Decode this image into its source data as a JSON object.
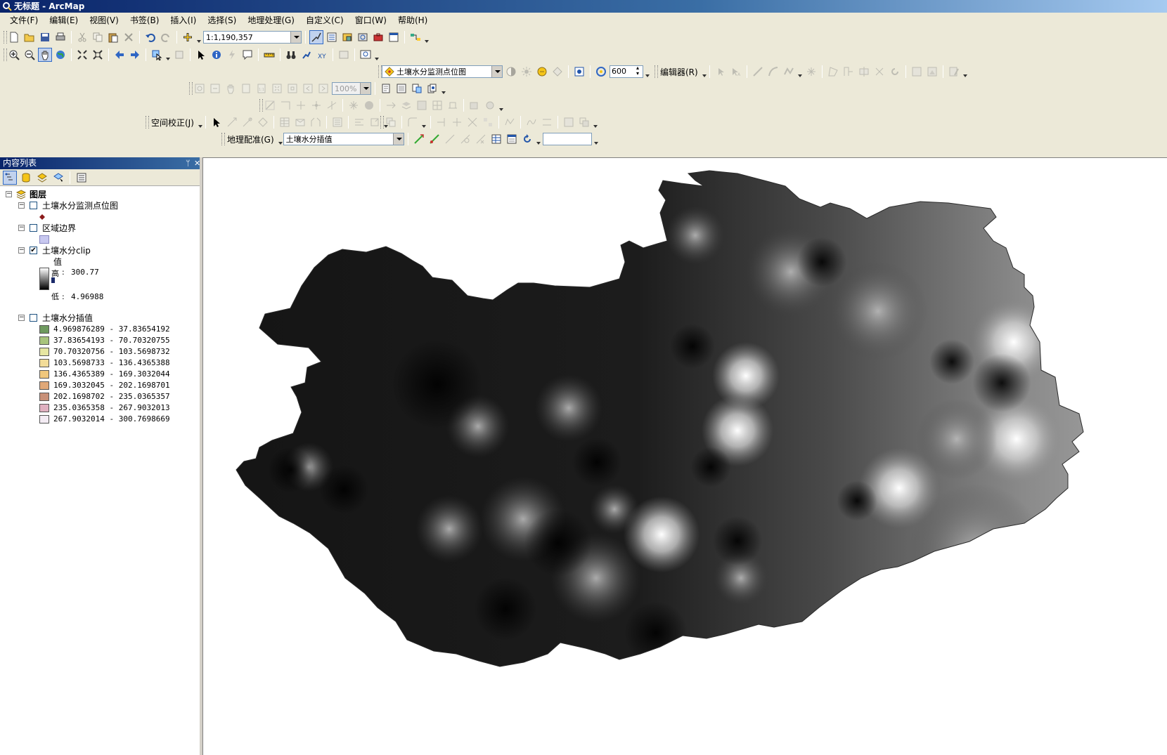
{
  "window": {
    "title": "无标题 - ArcMap"
  },
  "menu": [
    "文件(F)",
    "编辑(E)",
    "视图(V)",
    "书签(B)",
    "插入(I)",
    "选择(S)",
    "地理处理(G)",
    "自定义(C)",
    "窗口(W)",
    "帮助(H)"
  ],
  "standard_toolbar": {
    "scale_value": "1:1,190,357"
  },
  "edit_toolbar": {
    "layer_combo": "土壤水分监测点位图",
    "tolerance_value": "600",
    "editor_label": "编辑器(R)"
  },
  "layout_toolbar": {
    "zoom_combo": "100%"
  },
  "spatial_adjust": {
    "label": "空间校正(J)"
  },
  "georef": {
    "label": "地理配准(G)",
    "layer_combo": "土壤水分插值",
    "input_value": ""
  },
  "toc": {
    "title": "内容列表",
    "root": "图层",
    "layers": [
      {
        "name": "土壤水分监测点位图",
        "checked": false
      },
      {
        "name": "区域边界",
        "checked": false
      },
      {
        "name": "土壤水分clip",
        "checked": true,
        "field": "值",
        "high_label": "高",
        "high": "300.77",
        "low_label": "低",
        "low": "4.96988"
      },
      {
        "name": "土壤水分插值",
        "checked": false
      }
    ],
    "classes": [
      {
        "label": "4.969876289 - 37.83654192",
        "color": "#6f9a5f"
      },
      {
        "label": "37.83654193 - 70.70320755",
        "color": "#a8c47c"
      },
      {
        "label": "70.70320756 - 103.5698732",
        "color": "#e6e6a2"
      },
      {
        "label": "103.5698733 - 136.4365388",
        "color": "#f2dc98"
      },
      {
        "label": "136.4365389 - 169.3032044",
        "color": "#f0c77c"
      },
      {
        "label": "169.3032045 - 202.1698701",
        "color": "#e0a878"
      },
      {
        "label": "202.1698702 - 235.0365357",
        "color": "#c89078"
      },
      {
        "label": "235.0365358 - 267.9032013",
        "color": "#e0b0c0"
      },
      {
        "label": "267.9032014 - 300.7698669",
        "color": "#f4ecf4"
      }
    ]
  },
  "colors": {
    "title_bar": "#0a246a",
    "chrome": "#ece9d8",
    "point_symbol": "#8b1a1a",
    "boundary_fill": "#c8c8f0"
  }
}
